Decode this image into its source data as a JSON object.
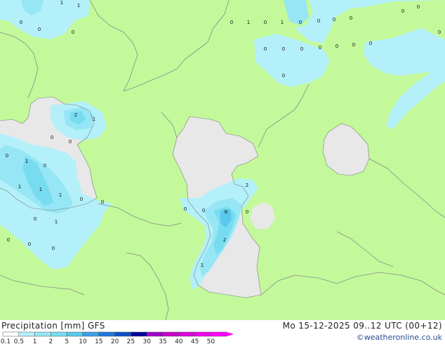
{
  "footer": {
    "title": "Precipitation [mm]  GFS",
    "datetime": "Mo 15-12-2025 09..12 UTC (00+12)",
    "credit": "©weatheronline.co.uk"
  },
  "legend": {
    "ticks": [
      "0.1",
      "0.5",
      "1",
      "2",
      "5",
      "10",
      "15",
      "20",
      "25",
      "30",
      "35",
      "40",
      "45",
      "50"
    ],
    "colors": [
      "#ffffff",
      "#b4f0fa",
      "#96e6f5",
      "#78dcf0",
      "#5ac8ec",
      "#3ca0e6",
      "#1e78dc",
      "#0a50c8",
      "#0000a0",
      "#a000c8",
      "#c800c8",
      "#dc00dc",
      "#f000f0",
      "#ff00ff"
    ]
  },
  "map": {
    "colors": {
      "land": "#c3f99a",
      "sea": "#e8e8e8",
      "border": "#8a8a8a",
      "coast": "#7c7c7c"
    },
    "value_labels": [
      "0",
      "0",
      "0",
      "1",
      "1",
      "0",
      "1",
      "0",
      "1",
      "0",
      "0",
      "0",
      "0",
      "0",
      "0",
      "0",
      "0",
      "0",
      "0",
      "0",
      "0",
      "0",
      "0",
      "0",
      "2",
      "1",
      "0",
      "0",
      "1",
      "0",
      "1",
      "1",
      "1",
      "0",
      "1",
      "0",
      "0",
      "0",
      "0",
      "0",
      "0",
      "2",
      "0",
      "0",
      "6",
      "0",
      "2",
      "1"
    ]
  }
}
